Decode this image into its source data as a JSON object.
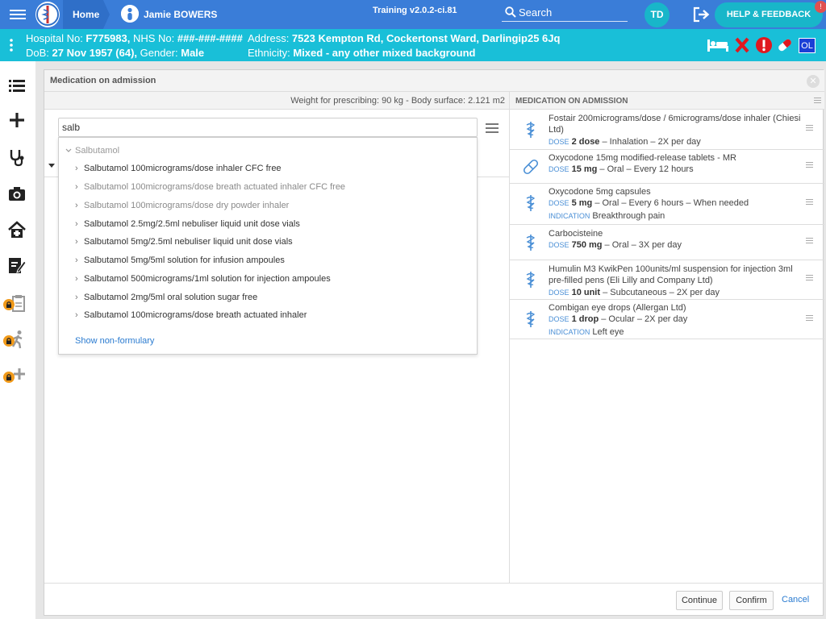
{
  "topbar": {
    "home": "Home",
    "patient_name": "Jamie BOWERS",
    "training": "Training v2.0.2-ci.81",
    "search": "Search",
    "avatar": "TD",
    "help": "HELP & FEEDBACK",
    "help_badge": "!"
  },
  "banner": {
    "hospital_label": "Hospital No: ",
    "hospital_no": "F775983,",
    "nhs_label": " NHS No: ",
    "nhs_no": "###-###-####",
    "dob_label": "DoB: ",
    "dob": "27 Nov 1957 (64),",
    "gender_label": " Gender: ",
    "gender": "Male",
    "address_label": "Address: ",
    "address": "7523 Kempton Rd, Cockertonst Ward, Darlingip25 6Jq",
    "ethnicity_label": "Ethnicity: ",
    "ethnicity": "Mixed - any other mixed background",
    "ol_badge": "OL"
  },
  "modal": {
    "title": "Medication on admission",
    "weight": "Weight for prescribing: 90 kg - Body surface: 2.121 m2",
    "search_value": "salb",
    "group": "Salbutamol",
    "results": [
      {
        "label": "Salbutamol 100micrograms/dose inhaler CFC free",
        "dim": false
      },
      {
        "label": "Salbutamol 100micrograms/dose breath actuated inhaler CFC free",
        "dim": true
      },
      {
        "label": "Salbutamol 100micrograms/dose dry powder inhaler",
        "dim": true
      },
      {
        "label": "Salbutamol 2.5mg/2.5ml nebuliser liquid unit dose vials",
        "dim": false
      },
      {
        "label": "Salbutamol 5mg/2.5ml nebuliser liquid unit dose vials",
        "dim": false
      },
      {
        "label": "Salbutamol 5mg/5ml solution for infusion ampoules",
        "dim": false
      },
      {
        "label": "Salbutamol 500micrograms/1ml solution for injection ampoules",
        "dim": false
      },
      {
        "label": "Salbutamol 2mg/5ml oral solution sugar free",
        "dim": false
      },
      {
        "label": "Salbutamol 100micrograms/dose breath actuated inhaler",
        "dim": false
      }
    ],
    "show_nonformulary": "Show non-formulary",
    "moa_title": "MEDICATION ON ADMISSION",
    "dose_tag": "DOSE",
    "indication_tag": "INDICATION",
    "meds": [
      {
        "name": "Fostair 200micrograms/dose / 6micrograms/dose inhaler (Chiesi Ltd)",
        "dose": "2 dose",
        "details": " – Inhalation – 2X per day",
        "indication": "",
        "icon": "inhaler-icon"
      },
      {
        "name": "Oxycodone 15mg modified-release tablets - MR",
        "dose": "15 mg",
        "details": " – Oral – Every 12 hours",
        "indication": "",
        "icon": "capsule-icon"
      },
      {
        "name": "Oxycodone 5mg capsules",
        "dose": "5 mg",
        "details": " – Oral – Every 6 hours – When needed",
        "indication": "Breakthrough pain",
        "icon": "inhaler-icon"
      },
      {
        "name": "Carbocisteine",
        "dose": "750 mg",
        "details": " – Oral – 3X per day",
        "indication": "",
        "icon": "inhaler-icon"
      },
      {
        "name": "Humulin M3 KwikPen 100units/ml suspension for injection 3ml pre-filled pens (Eli Lilly and Company Ltd)",
        "dose": "10 unit",
        "details": " – Subcutaneous – 2X per day",
        "indication": "",
        "icon": "inhaler-icon"
      },
      {
        "name": "Combigan eye drops (Allergan Ltd)",
        "dose": "1 drop",
        "details": " – Ocular – 2X per day",
        "indication": "Left eye",
        "icon": "inhaler-icon"
      }
    ],
    "continue": "Continue",
    "confirm": "Confirm",
    "cancel": "Cancel"
  }
}
